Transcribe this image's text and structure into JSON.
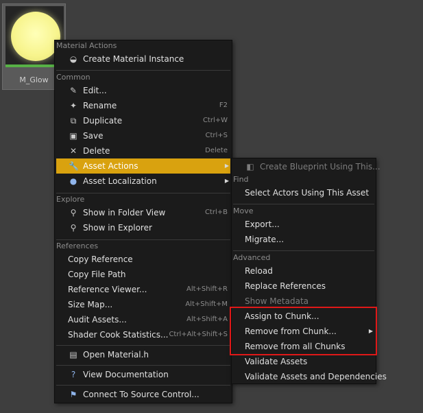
{
  "asset": {
    "name": "M_Glow"
  },
  "main_menu": {
    "sections": {
      "material_actions": "Material Actions",
      "common": "Common",
      "explore": "Explore",
      "references": "References"
    },
    "items": {
      "create_material_instance": {
        "label": "Create Material Instance",
        "icon": "material-instance-icon"
      },
      "edit": {
        "label": "Edit...",
        "icon": "pencil-icon"
      },
      "rename": {
        "label": "Rename",
        "shortcut": "F2",
        "icon": "rename-icon"
      },
      "duplicate": {
        "label": "Duplicate",
        "shortcut": "Ctrl+W",
        "icon": "duplicate-icon"
      },
      "save": {
        "label": "Save",
        "shortcut": "Ctrl+S",
        "icon": "save-icon"
      },
      "delete": {
        "label": "Delete",
        "shortcut": "Delete",
        "icon": "delete-icon"
      },
      "asset_actions": {
        "label": "Asset Actions",
        "icon": "wrench-icon"
      },
      "asset_localization": {
        "label": "Asset Localization",
        "icon": "globe-icon"
      },
      "show_in_folder_view": {
        "label": "Show in Folder View",
        "shortcut": "Ctrl+B",
        "icon": "search-icon"
      },
      "show_in_explorer": {
        "label": "Show in Explorer",
        "icon": "search-icon"
      },
      "copy_reference": {
        "label": "Copy Reference"
      },
      "copy_file_path": {
        "label": "Copy File Path"
      },
      "reference_viewer": {
        "label": "Reference Viewer...",
        "shortcut": "Alt+Shift+R"
      },
      "size_map": {
        "label": "Size Map...",
        "shortcut": "Alt+Shift+M"
      },
      "audit_assets": {
        "label": "Audit Assets...",
        "shortcut": "Alt+Shift+A"
      },
      "shader_cook_statistics": {
        "label": "Shader Cook Statistics...",
        "shortcut": "Ctrl+Alt+Shift+S"
      },
      "open_material_h": {
        "label": "Open Material.h",
        "icon": "code-file-icon"
      },
      "view_documentation": {
        "label": "View Documentation",
        "icon": "help-icon"
      },
      "connect_source_control": {
        "label": "Connect To Source Control...",
        "icon": "source-control-icon"
      }
    }
  },
  "sub_menu": {
    "sections": {
      "find": "Find",
      "move": "Move",
      "advanced": "Advanced"
    },
    "items": {
      "create_blueprint": {
        "label": "Create Blueprint Using This...",
        "icon": "blueprint-icon"
      },
      "select_actors": {
        "label": "Select Actors Using This Asset"
      },
      "export": {
        "label": "Export..."
      },
      "migrate": {
        "label": "Migrate..."
      },
      "reload": {
        "label": "Reload"
      },
      "replace_references": {
        "label": "Replace References"
      },
      "show_metadata": {
        "label": "Show Metadata"
      },
      "assign_to_chunk": {
        "label": "Assign to Chunk..."
      },
      "remove_from_chunk": {
        "label": "Remove from Chunk..."
      },
      "remove_from_all_chunks": {
        "label": "Remove from all Chunks"
      },
      "validate_assets": {
        "label": "Validate Assets"
      },
      "validate_assets_deps": {
        "label": "Validate Assets and Dependencies"
      }
    }
  },
  "colors": {
    "menu_bg": "#1b1b1b",
    "highlight": "#d9a20f",
    "annotation_box": "#e01818",
    "thumbnail_glow": "#f7f48c",
    "asset_type_bar": "#57b146"
  }
}
